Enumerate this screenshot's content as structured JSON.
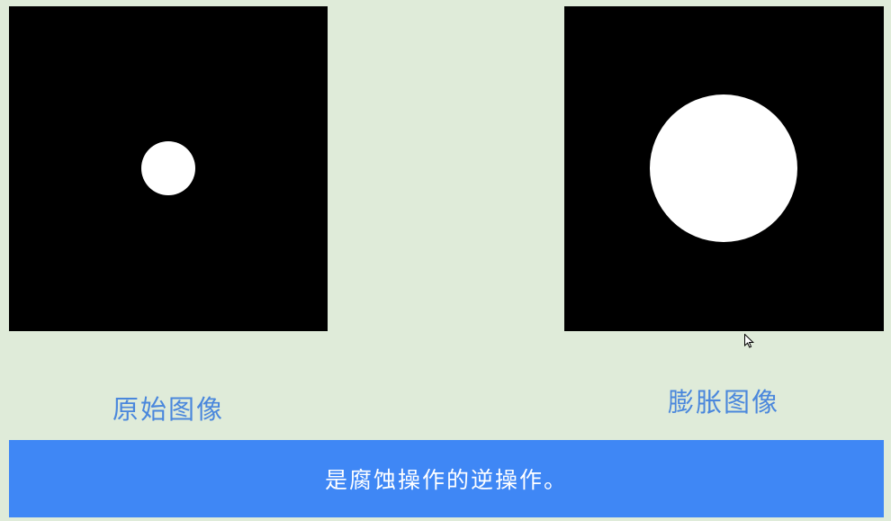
{
  "slide": {
    "original_caption": "原始图像",
    "dilated_caption": "膨胀图像",
    "banner_text": "是腐蚀操作的逆操作。"
  },
  "colors": {
    "background": "#dfebd9",
    "image_background": "#000000",
    "shape": "#ffffff",
    "caption_text": "#4a87dc",
    "banner": "#3f87f5",
    "banner_text": "#ffffff"
  },
  "icons": {
    "cursor": "mouse-pointer-icon"
  }
}
